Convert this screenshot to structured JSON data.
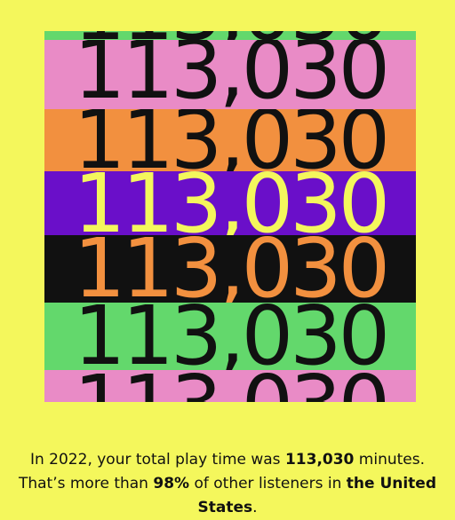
{
  "artwork": {
    "number_text": "113,030",
    "bands": [
      {
        "bg": "#63d86c",
        "fg": "#111111"
      },
      {
        "bg": "#e98bc6",
        "fg": "#111111"
      },
      {
        "bg": "#f2903f",
        "fg": "#111111"
      },
      {
        "bg": "#6a0fc9",
        "fg": "#f4f75c"
      },
      {
        "bg": "#111111",
        "fg": "#f2903f"
      },
      {
        "bg": "#63d86c",
        "fg": "#111111"
      },
      {
        "bg": "#e98bc6",
        "fg": "#111111"
      }
    ]
  },
  "caption": {
    "part1": "In 2022, your total play time was ",
    "minutes_value": "113,030",
    "part2": " minutes. That’s more than ",
    "percent_value": "98%",
    "part3": " of other listeners in ",
    "country": "the United States",
    "part4": "."
  }
}
